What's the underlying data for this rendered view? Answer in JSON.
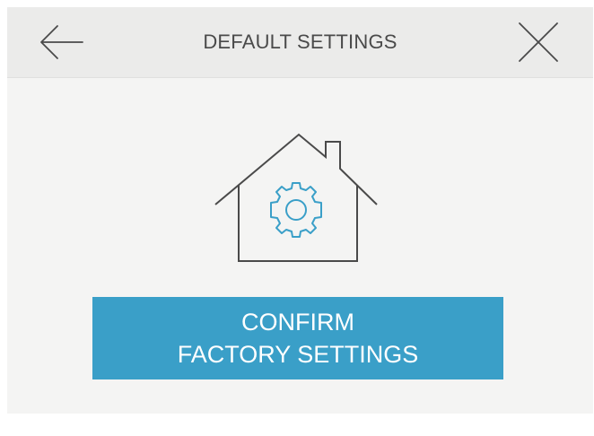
{
  "header": {
    "title": "DEFAULT SETTINGS",
    "back_icon": "arrow-left-icon",
    "close_icon": "close-icon"
  },
  "main": {
    "illustration_icon": "house-gear-icon",
    "confirm_button": {
      "line1": "CONFIRM",
      "line2": "FACTORY SETTINGS"
    }
  },
  "colors": {
    "accent": "#3a9fc8",
    "header_bg": "#ebebea",
    "screen_bg": "#f4f4f3",
    "icon_stroke": "#4a4a4a"
  }
}
